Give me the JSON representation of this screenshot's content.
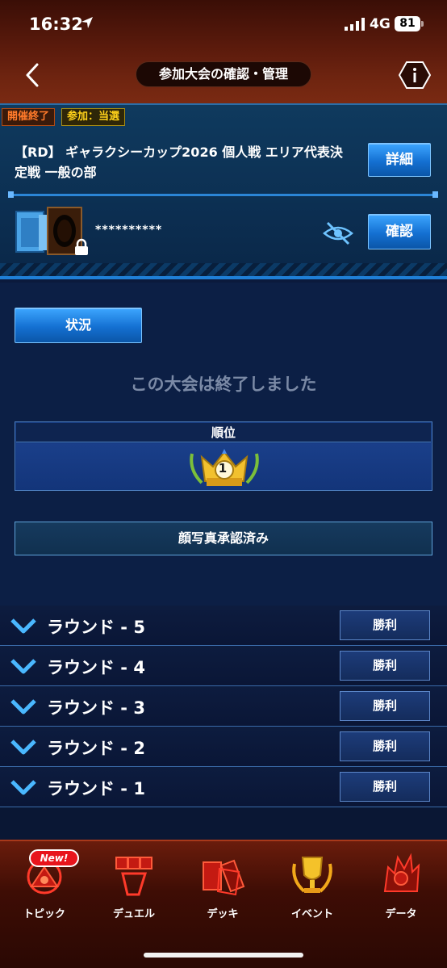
{
  "status_bar": {
    "time": "16:32",
    "network": "4G",
    "battery": "81"
  },
  "header": {
    "title": "参加大会の確認・管理"
  },
  "tournament": {
    "badge_status": "開催終了",
    "badge_entry": "参加：当選",
    "name": "【RD】 ギャラクシーカップ2026 個人戦 エリア代表決定戦 一般の部",
    "detail_label": "詳細",
    "deck_code": "**********",
    "confirm_label": "確認"
  },
  "main": {
    "status_tab": "状況",
    "ended_message": "この大会は終了しました",
    "rank_header": "順位",
    "rank_value": "1",
    "photo_status": "顔写真承認済み"
  },
  "rounds": [
    {
      "label": "ラウンド - 5",
      "result": "勝利"
    },
    {
      "label": "ラウンド - 4",
      "result": "勝利"
    },
    {
      "label": "ラウンド - 3",
      "result": "勝利"
    },
    {
      "label": "ラウンド - 2",
      "result": "勝利"
    },
    {
      "label": "ラウンド - 1",
      "result": "勝利"
    }
  ],
  "bottom_nav": {
    "new_badge": "New!",
    "items": [
      {
        "label": "トピック",
        "icon": "topic-icon"
      },
      {
        "label": "デュエル",
        "icon": "duel-icon"
      },
      {
        "label": "デッキ",
        "icon": "deck-icon"
      },
      {
        "label": "イベント",
        "icon": "event-trophy-icon"
      },
      {
        "label": "データ",
        "icon": "data-icon"
      }
    ]
  }
}
